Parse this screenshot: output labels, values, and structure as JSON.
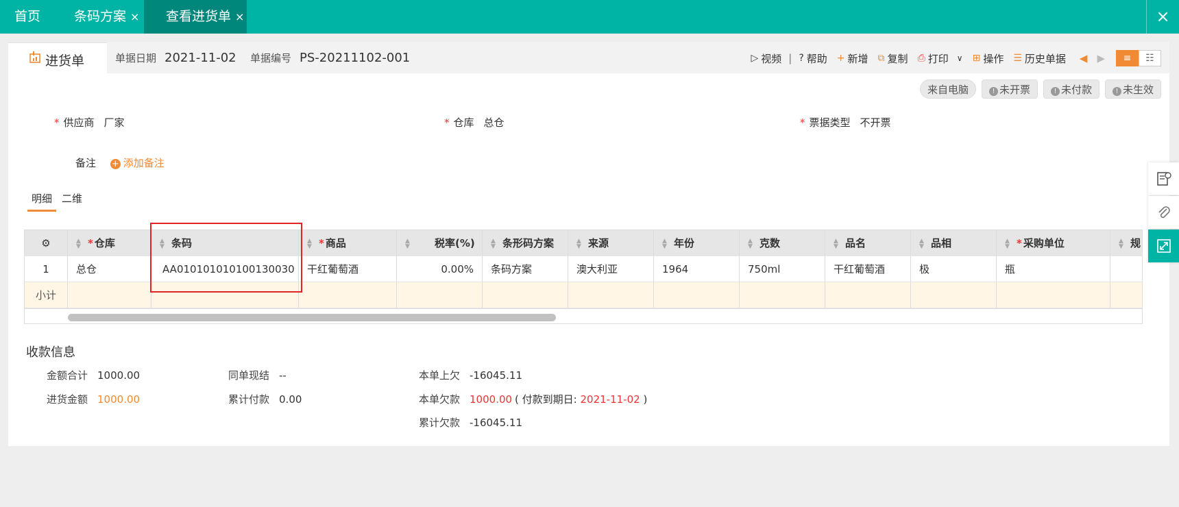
{
  "tabs": [
    {
      "label": "首页",
      "closable": false
    },
    {
      "label": "条码方案",
      "closable": true
    },
    {
      "label": "查看进货单",
      "closable": true,
      "active": true
    }
  ],
  "close_glyph": "×",
  "doc": {
    "title": "进货单",
    "date_label": "单据日期",
    "date": "2021-11-02",
    "no_label": "单据编号",
    "no": "PS-20211102-001"
  },
  "toolbar": {
    "video": "视频",
    "help": "帮助",
    "add": "新增",
    "copy": "复制",
    "print": "打印",
    "ops": "操作",
    "history": "历史单据"
  },
  "status": {
    "source": "来自电脑",
    "invoice": "未开票",
    "payment": "未付款",
    "effective": "未生效"
  },
  "form": {
    "supplier_label": "供应商",
    "supplier": "厂家",
    "warehouse_label": "仓库",
    "warehouse": "总仓",
    "bill_type_label": "票据类型",
    "bill_type": "不开票",
    "note_label": "备注",
    "add_note": "添加备注"
  },
  "subtabs": [
    "明细",
    "二维"
  ],
  "grid": {
    "headers": [
      "仓库",
      "条码",
      "商品",
      "税率(%)",
      "条形码方案",
      "来源",
      "年份",
      "克数",
      "品名",
      "品相",
      "采购单位",
      "规"
    ],
    "row": {
      "index": "1",
      "warehouse": "总仓",
      "barcode": "AA010101010100130030",
      "product": "干红葡萄酒",
      "tax": "0.00%",
      "scheme": "条码方案",
      "origin": "澳大利亚",
      "year": "1964",
      "grams": "750ml",
      "name": "干红葡萄酒",
      "grade": "极",
      "unit": "瓶"
    },
    "subtotal": "小计"
  },
  "payment": {
    "title": "收款信息",
    "total_label": "金额合计",
    "total": "1000.00",
    "cash_label": "同单现结",
    "cash": "--",
    "prev_debt_label": "本单上欠",
    "prev_debt": "-16045.11",
    "purchase_label": "进货金额",
    "purchase": "1000.00",
    "paid_label": "累计付款",
    "paid": "0.00",
    "owe_label": "本单欠款",
    "owe": "1000.00",
    "due_prefix": "( 付款到期日: ",
    "due_date": "2021-11-02",
    "due_suffix": " )",
    "cum_debt_label": "累计欠款",
    "cum_debt": "-16045.11"
  },
  "colors": {
    "teal": "#00b4a5",
    "accent": "#f08a35",
    "danger": "#e33"
  }
}
